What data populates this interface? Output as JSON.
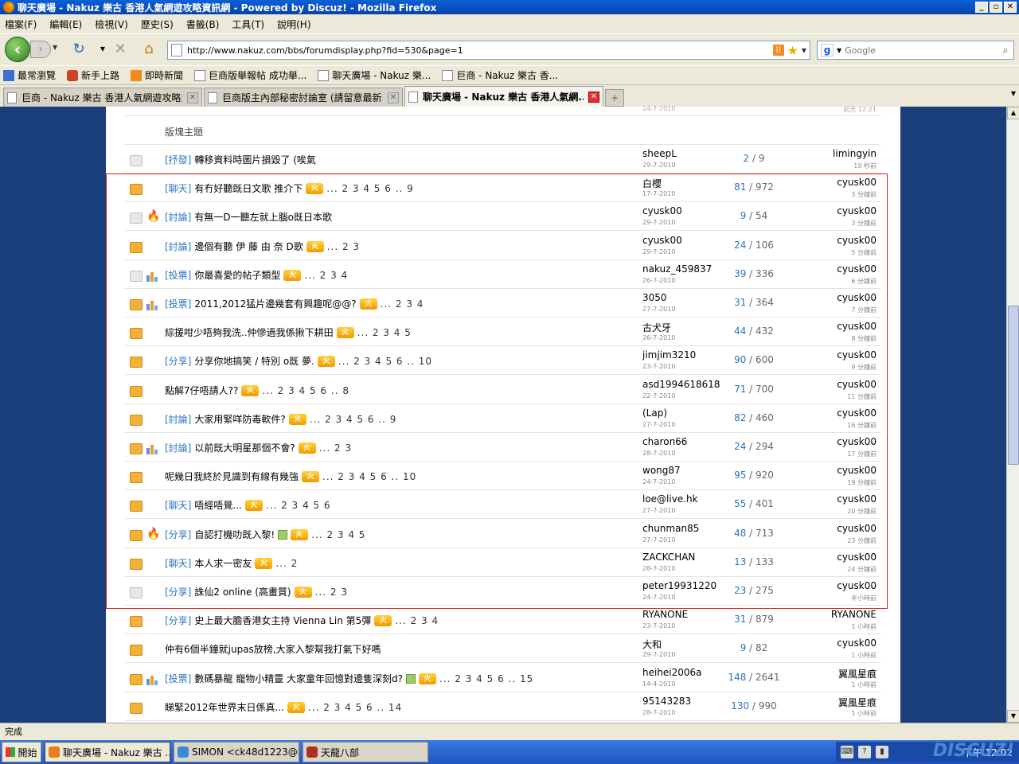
{
  "window": {
    "title": "聊天廣場 - Nakuz 樂古 香港人氣網遊攻略資訊網 - Powered by Discuz! - Mozilla Firefox"
  },
  "menu": [
    "檔案(F)",
    "編輯(E)",
    "檢視(V)",
    "歷史(S)",
    "書籤(B)",
    "工具(T)",
    "說明(H)"
  ],
  "nav": {
    "url": "http://www.nakuz.com/bbs/forumdisplay.php?fid=530&page=1",
    "search_placeholder": "Google"
  },
  "bookmarks": [
    "最常瀏覽",
    "新手上路",
    "即時新聞",
    "巨商版舉報帖 成功舉...",
    "聊天廣場 - Nakuz 樂...",
    "巨商 - Nakuz 樂古 香..."
  ],
  "tabs": [
    {
      "label": "巨商 - Nakuz 樂古 香港人氣網遊攻略資...",
      "active": false
    },
    {
      "label": "巨商版主內部秘密討論室 (請留意最新...",
      "active": false
    },
    {
      "label": "聊天廣場 - Nakuz 樂古 香港人氣網...",
      "active": true
    }
  ],
  "top_partial": {
    "date": "24-7-2010",
    "last": "前天 12:21"
  },
  "section_header": "版塊主題",
  "threads": [
    {
      "cat": "[抒發]",
      "title": "轉移資料時圖片損毀了 (唉氣",
      "pages": "",
      "author": "sheepL",
      "date": "29-7-2010",
      "replies": "2",
      "views": "9",
      "last": "limingyin",
      "ltime": "19 秒前",
      "folder": "grey",
      "extra": "",
      "hot": false,
      "att": false
    },
    {
      "cat": "[聊天]",
      "title": "有冇好聽既日文歌 推介下",
      "pages": "... 2 3 4 5 6 .. 9",
      "author": "白櫻",
      "date": "17-7-2010",
      "replies": "81",
      "views": "972",
      "last": "cyusk00",
      "ltime": "3 分鐘前",
      "folder": "orange",
      "extra": "",
      "hot": true,
      "att": false
    },
    {
      "cat": "[討論]",
      "title": "有無一D一聽左就上腦o既日本歌",
      "pages": "",
      "author": "cyusk00",
      "date": "29-7-2010",
      "replies": "9",
      "views": "54",
      "last": "cyusk00",
      "ltime": "3 分鐘前",
      "folder": "grey",
      "extra": "fire",
      "hot": false,
      "att": false
    },
    {
      "cat": "[討論]",
      "title": "邊個有聽 伊 藤 由 奈 D歌",
      "pages": "... 2 3",
      "author": "cyusk00",
      "date": "29-7-2010",
      "replies": "24",
      "views": "106",
      "last": "cyusk00",
      "ltime": "5 分鐘前",
      "folder": "orange",
      "extra": "",
      "hot": true,
      "att": false
    },
    {
      "cat": "[投票]",
      "title": "你最喜愛的帖子類型",
      "pages": "... 2 3 4",
      "author": "nakuz_459837",
      "date": "26-7-2010",
      "replies": "39",
      "views": "336",
      "last": "cyusk00",
      "ltime": "6 分鐘前",
      "folder": "grey",
      "extra": "poll",
      "hot": true,
      "att": false
    },
    {
      "cat": "[投票]",
      "title": "2011,2012猛片邊幾套有興趣呢@@?",
      "pages": "... 2 3 4",
      "author": "3050",
      "date": "27-7-2010",
      "replies": "31",
      "views": "364",
      "last": "cyusk00",
      "ltime": "7 分鐘前",
      "folder": "orange",
      "extra": "poll",
      "hot": true,
      "att": false
    },
    {
      "cat": "",
      "title": "綜援咁少唔夠我洗..仲慘過我係揪下耕田",
      "pages": "... 2 3 4 5",
      "author": "古犬牙",
      "date": "26-7-2010",
      "replies": "44",
      "views": "432",
      "last": "cyusk00",
      "ltime": "8 分鐘前",
      "folder": "orange",
      "extra": "",
      "hot": true,
      "att": false
    },
    {
      "cat": "[分享]",
      "title": "分享你地搞笑 / 特別 o既 夢.",
      "pages": "... 2 3 4 5 6 .. 10",
      "author": "jimjim3210",
      "date": "23-7-2010",
      "replies": "90",
      "views": "600",
      "last": "cyusk00",
      "ltime": "9 分鐘前",
      "folder": "orange",
      "extra": "",
      "hot": true,
      "att": false
    },
    {
      "cat": "",
      "title": "點解7仔唔請人??",
      "pages": "... 2 3 4 5 6 .. 8",
      "author": "asd1994618618",
      "date": "22-7-2010",
      "replies": "71",
      "views": "700",
      "last": "cyusk00",
      "ltime": "11 分鐘前",
      "folder": "orange",
      "extra": "",
      "hot": true,
      "att": false
    },
    {
      "cat": "[討論]",
      "title": "大家用緊咩防毒軟件?",
      "pages": "... 2 3 4 5 6 .. 9",
      "author": "(Lap)",
      "date": "27-7-2010",
      "replies": "82",
      "views": "460",
      "last": "cyusk00",
      "ltime": "16 分鐘前",
      "folder": "orange",
      "extra": "",
      "hot": true,
      "att": false
    },
    {
      "cat": "[討論]",
      "title": "以前既大明星那個不會?",
      "pages": "... 2 3",
      "author": "charon66",
      "date": "28-7-2010",
      "replies": "24",
      "views": "294",
      "last": "cyusk00",
      "ltime": "17 分鐘前",
      "folder": "orange",
      "extra": "poll",
      "hot": true,
      "att": false
    },
    {
      "cat": "",
      "title": "呢幾日我終於見識到有線有幾強",
      "pages": "... 2 3 4 5 6 .. 10",
      "author": "wong87",
      "date": "24-7-2010",
      "replies": "95",
      "views": "920",
      "last": "cyusk00",
      "ltime": "19 分鐘前",
      "folder": "orange",
      "extra": "",
      "hot": true,
      "att": false
    },
    {
      "cat": "[聊天]",
      "title": "唔經唔覺...",
      "pages": "... 2 3 4 5 6",
      "author": "loe@live.hk",
      "date": "27-7-2010",
      "replies": "55",
      "views": "401",
      "last": "cyusk00",
      "ltime": "20 分鐘前",
      "folder": "orange",
      "extra": "",
      "hot": true,
      "att": false
    },
    {
      "cat": "[分享]",
      "title": "自認打機叻既入黎!",
      "pages": "... 2 3 4 5",
      "author": "chunman85",
      "date": "27-7-2010",
      "replies": "48",
      "views": "713",
      "last": "cyusk00",
      "ltime": "23 分鐘前",
      "folder": "orange",
      "extra": "fire",
      "hot": true,
      "att": true
    },
    {
      "cat": "[聊天]",
      "title": "本人求一密友",
      "pages": "... 2",
      "author": "ZACKCHAN",
      "date": "28-7-2010",
      "replies": "13",
      "views": "133",
      "last": "cyusk00",
      "ltime": "24 分鐘前",
      "folder": "orange",
      "extra": "",
      "hot": true,
      "att": false
    },
    {
      "cat": "[分享]",
      "title": "誅仙2 online (高畫質)",
      "pages": "... 2 3",
      "author": "peter19931220",
      "date": "24-7-2010",
      "replies": "23",
      "views": "275",
      "last": "cyusk00",
      "ltime": "半小時前",
      "folder": "grey",
      "extra": "",
      "hot": true,
      "att": false
    },
    {
      "cat": "[分享]",
      "title": "史上最大膽香港女主持 Vienna Lin 第5彈",
      "pages": "... 2 3 4",
      "author": "RYANONE",
      "date": "23-7-2010",
      "replies": "31",
      "views": "879",
      "last": "RYANONE",
      "ltime": "1 小時前",
      "folder": "orange",
      "extra": "",
      "hot": true,
      "att": false
    },
    {
      "cat": "",
      "title": "仲有6個半鐘就jupas放榜,大家入黎幫我打氣下好嗎",
      "pages": "",
      "author": "大和",
      "date": "29-7-2010",
      "replies": "9",
      "views": "82",
      "last": "cyusk00",
      "ltime": "1 小時前",
      "folder": "orange",
      "extra": "",
      "hot": false,
      "att": false
    },
    {
      "cat": "[投票]",
      "title": "數碼暴龍 寵物小精靈 大家童年回憶對邊隻深刻d?",
      "pages": "... 2 3 4 5 6 .. 15",
      "author": "heihei2006a",
      "date": "14-4-2010",
      "replies": "148",
      "views": "2641",
      "last": "翼風星痕",
      "ltime": "1 小時前",
      "folder": "orange",
      "extra": "poll",
      "hot": true,
      "att": true
    },
    {
      "cat": "",
      "title": "睇緊2012年世界末日係真...",
      "pages": "... 2 3 4 5 6 .. 14",
      "author": "95143283",
      "date": "28-7-2010",
      "replies": "130",
      "views": "990",
      "last": "翼風星痕",
      "ltime": "1 小時前",
      "folder": "orange",
      "extra": "",
      "hot": true,
      "att": false
    }
  ],
  "hot_label": "火",
  "status": "完成",
  "taskbar": {
    "start": "開始",
    "tasks": [
      "聊天廣場 - Nakuz 樂古 ...",
      "SIMON <ck48d1223@ho...",
      "天龍八部"
    ],
    "clock": "下午 12:02",
    "watermark": "DISCUZ!"
  }
}
